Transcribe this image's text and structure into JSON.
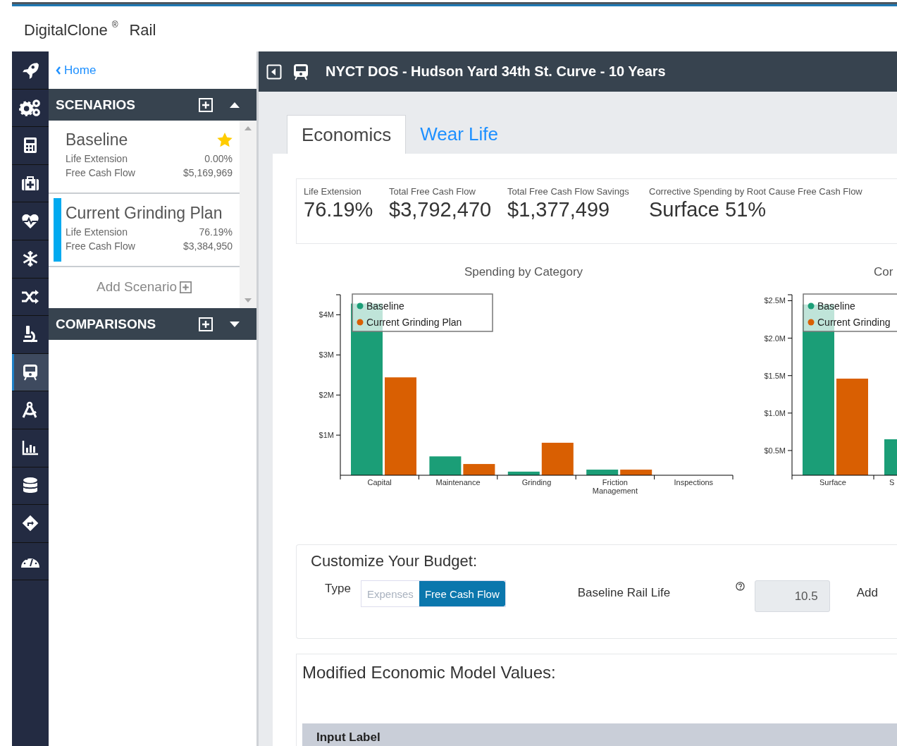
{
  "header": {
    "brand": "DigitalClone",
    "brand_mark": "®",
    "product": "Rail"
  },
  "nav_rail": [
    {
      "selected": false
    },
    {
      "selected": false
    },
    {
      "selected": false
    },
    {
      "selected": false
    },
    {
      "selected": false
    },
    {
      "selected": false
    },
    {
      "selected": false
    },
    {
      "selected": false
    },
    {
      "selected": true
    },
    {
      "selected": false
    },
    {
      "selected": false
    },
    {
      "selected": false
    },
    {
      "selected": false
    },
    {
      "selected": false
    }
  ],
  "panel": {
    "home_link": "Home",
    "scenarios": {
      "title": "SCENARIOS",
      "expanded": true,
      "add_label": "Add Scenario",
      "items": [
        {
          "name": "Baseline",
          "starred": true,
          "selected": false,
          "rows": [
            {
              "label": "Life Extension",
              "value": "0.00%"
            },
            {
              "label": "Free Cash Flow",
              "value": "$5,169,969"
            }
          ]
        },
        {
          "name": "Current Grinding Plan",
          "starred": false,
          "selected": true,
          "rows": [
            {
              "label": "Life Extension",
              "value": "76.19%"
            },
            {
              "label": "Free Cash Flow",
              "value": "$3,384,950"
            }
          ]
        }
      ]
    },
    "comparisons": {
      "title": "COMPARISONS",
      "expanded": false
    }
  },
  "main": {
    "title": "NYCT DOS - Hudson Yard 34th St. Curve - 10 Years",
    "tabs": [
      {
        "label": "Economics",
        "selected": true
      },
      {
        "label": "Wear Life",
        "selected": false
      }
    ],
    "kpis": [
      {
        "label": "Life Extension",
        "value": "76.19%"
      },
      {
        "label": "Total Free Cash Flow",
        "value": "$3,792,470"
      },
      {
        "label": "Total Free Cash Flow Savings",
        "value": "$1,377,499"
      },
      {
        "label": "Corrective Spending by Root Cause Free Cash Flow",
        "value": "Surface 51%"
      }
    ],
    "charts": [
      {
        "chart_data": {
          "type": "bar",
          "legend": true,
          "title": "Spending by Category",
          "categories": [
            "Capital",
            "Maintenance",
            "Grinding",
            "Friction Management",
            "Inspections"
          ],
          "ylim": [
            0,
            4.5
          ],
          "yticks": [
            {
              "value": 1,
              "label": "$1M"
            },
            {
              "value": 2,
              "label": "$2M"
            },
            {
              "value": 3,
              "label": "$3M"
            },
            {
              "value": 4,
              "label": "$4M"
            }
          ],
          "series": [
            {
              "name": "Baseline",
              "color": "#1b9e77",
              "values": [
                4.28,
                0.47,
                0.09,
                0.14,
                0
              ]
            },
            {
              "name": "Current Grinding Plan",
              "color": "#d95f02",
              "values": [
                2.44,
                0.28,
                0.81,
                0.14,
                0
              ]
            }
          ]
        }
      },
      {
        "chart_data": {
          "type": "bar",
          "legend": true,
          "title": "Cor",
          "categories": [
            "Surface",
            "S"
          ],
          "ylim": [
            0.17,
            2.58
          ],
          "yticks": [
            {
              "value": 0.5,
              "label": "$0.5M"
            },
            {
              "value": 1,
              "label": "$1.0M"
            },
            {
              "value": 1.5,
              "label": "$1.5M"
            },
            {
              "value": 2,
              "label": "$2.0M"
            },
            {
              "value": 2.5,
              "label": "$2.5M"
            }
          ],
          "series": [
            {
              "name": "Baseline",
              "color": "#1b9e77",
              "values": [
                2.45,
                0.65
              ]
            },
            {
              "name": "Current Grinding",
              "color": "#d95f02",
              "values": [
                1.46,
                null
              ]
            }
          ]
        }
      }
    ],
    "budget": {
      "title": "Customize Your Budget:",
      "type_label": "Type",
      "options": [
        {
          "label": "Expenses",
          "selected": false
        },
        {
          "label": "Free Cash Flow",
          "selected": true
        }
      ],
      "rail_life_label": "Baseline Rail Life",
      "rail_life_value": "10.5",
      "next_label": "Add"
    },
    "model_values": {
      "title": "Modified Economic Model Values:",
      "columns": [
        "Input Label"
      ]
    }
  }
}
